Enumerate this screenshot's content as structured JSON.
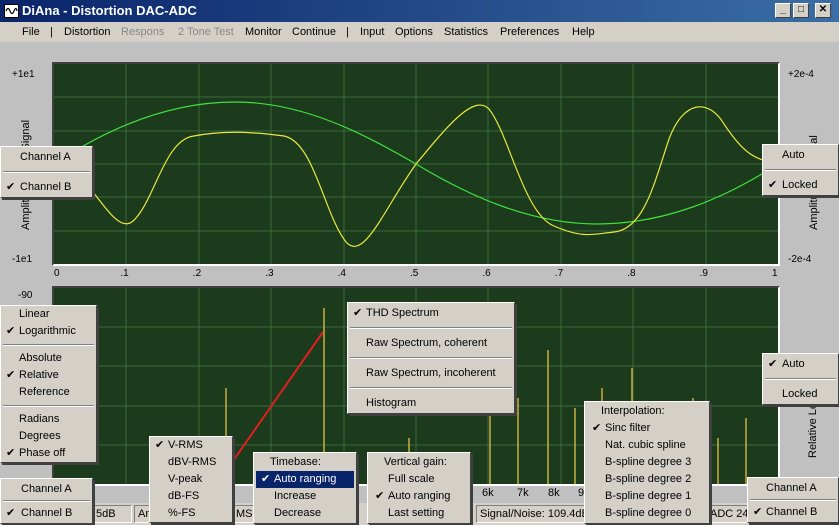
{
  "window": {
    "title": "DiAna - Distortion DAC-ADC",
    "controls": [
      "_",
      "□",
      "✕"
    ]
  },
  "menu": {
    "items": [
      {
        "label": "File",
        "enabled": true
      },
      {
        "label": "|",
        "enabled": true
      },
      {
        "label": "Distortion",
        "enabled": true
      },
      {
        "label": "Respons",
        "enabled": false
      },
      {
        "label": "2 Tone Test",
        "enabled": false
      },
      {
        "label": "Monitor",
        "enabled": true
      },
      {
        "label": "Continue",
        "enabled": true
      },
      {
        "label": "|",
        "enabled": true
      },
      {
        "label": "Input",
        "enabled": true
      },
      {
        "label": "Options",
        "enabled": true
      },
      {
        "label": "Statistics",
        "enabled": true
      },
      {
        "label": "Preferences",
        "enabled": true
      },
      {
        "label": "Help",
        "enabled": true
      }
    ]
  },
  "top_plot": {
    "left_top_label": "+1e1",
    "left_bottom_label": "-1e1",
    "right_top_label": "+2e-4",
    "right_bottom_label": "-2e-4",
    "left_axis_title": "Amplitude Input Signal",
    "right_axis_title": "Amplitude Residual",
    "x_ticks": [
      "0",
      ".1",
      ".2",
      ".3",
      ".4",
      ".5",
      ".6",
      ".7",
      ".8",
      ".9",
      "1"
    ],
    "colors": {
      "signal": "#40e040",
      "residual": "#e8e840",
      "grid": "#3a6a3a",
      "background": "#1c3a1c"
    }
  },
  "bottom_plot": {
    "left_top_label": "-90",
    "right_axis_title": "Relative Level (dBV)",
    "freq_labels": [
      "6k",
      "7k",
      "8k",
      "9"
    ]
  },
  "popups": {
    "channel_top_left": {
      "items": [
        {
          "label": "Channel A",
          "checked": false
        },
        {
          "label": "Channel B",
          "checked": true
        }
      ]
    },
    "range_top_right": {
      "items": [
        {
          "label": "Auto",
          "checked": false
        },
        {
          "label": "Locked",
          "checked": true
        }
      ]
    },
    "scale_menu": {
      "groups": [
        [
          {
            "label": "Linear",
            "checked": false
          },
          {
            "label": "Logarithmic",
            "checked": true
          }
        ],
        [
          {
            "label": "Absolute",
            "checked": false
          },
          {
            "label": "Relative",
            "checked": true
          },
          {
            "label": "Reference",
            "checked": false
          }
        ],
        [
          {
            "label": "Radians",
            "checked": false
          },
          {
            "label": "Degrees",
            "checked": false
          },
          {
            "label": "Phase off",
            "checked": true
          }
        ]
      ]
    },
    "spectrum_menu": {
      "items": [
        {
          "label": "THD Spectrum",
          "checked": true
        },
        {
          "label": "Raw Spectrum, coherent",
          "checked": false
        },
        {
          "label": "Raw Spectrum, incoherent",
          "checked": false
        },
        {
          "label": "Histogram",
          "checked": false
        }
      ]
    },
    "range_mid_right": {
      "items": [
        {
          "label": "Auto",
          "checked": true
        },
        {
          "label": "Locked",
          "checked": false
        }
      ]
    },
    "units_menu": {
      "items": [
        {
          "label": "V-RMS",
          "checked": true
        },
        {
          "label": "dBV-RMS",
          "checked": false
        },
        {
          "label": "V-peak",
          "checked": false
        },
        {
          "label": "dB-FS",
          "checked": false
        },
        {
          "label": "%-FS",
          "checked": false
        }
      ]
    },
    "timebase_menu": {
      "header": "Timebase:",
      "items": [
        {
          "label": "Auto ranging",
          "checked": true,
          "selected": true
        },
        {
          "label": "Increase",
          "checked": false,
          "selected": false
        },
        {
          "label": "Decrease",
          "checked": false,
          "selected": false
        }
      ]
    },
    "vgain_menu": {
      "header": "Vertical gain:",
      "items": [
        {
          "label": "Full scale",
          "checked": false
        },
        {
          "label": "Auto ranging",
          "checked": true
        },
        {
          "label": "Last  setting",
          "checked": false
        }
      ]
    },
    "interp_menu": {
      "header": "Interpolation:",
      "items": [
        {
          "label": "Sinc filter",
          "checked": true
        },
        {
          "label": "Nat. cubic spline",
          "checked": false
        },
        {
          "label": "B-spline degree 3",
          "checked": false
        },
        {
          "label": "B-spline degree 2",
          "checked": false
        },
        {
          "label": "B-spline degree 1",
          "checked": false
        },
        {
          "label": "B-spline degree 0",
          "checked": false
        }
      ]
    },
    "channel_bottom_left": {
      "items": [
        {
          "label": "Channel A",
          "checked": false
        },
        {
          "label": "Channel B",
          "checked": true
        }
      ]
    },
    "channel_bottom_right": {
      "items": [
        {
          "label": "Channel A",
          "checked": false
        },
        {
          "label": "Channel B",
          "checked": true
        }
      ]
    }
  },
  "status": {
    "cells": [
      "5dB",
      "Am",
      "MS",
      "Signal/Noise:  109.4dB",
      "ADC 24"
    ]
  }
}
